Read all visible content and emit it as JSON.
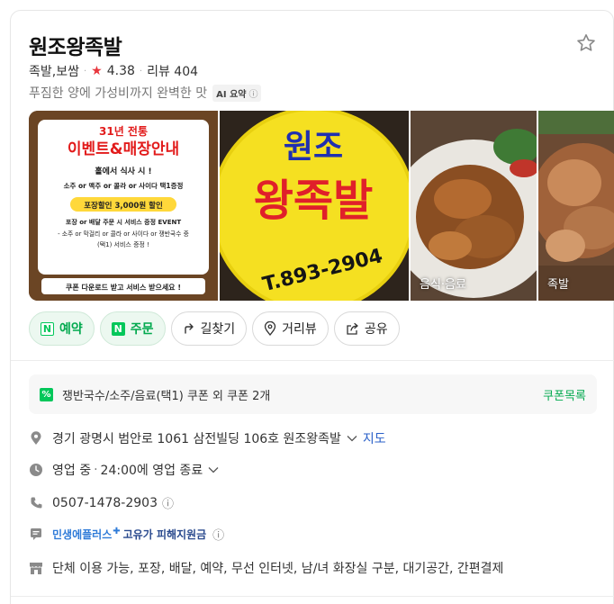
{
  "place": {
    "name": "원조왕족발",
    "category": "족발,보쌈",
    "rating": "4.38",
    "review_label": "리뷰 404",
    "summary": "푸짐한 양에 가성비까지 완벽한 맛",
    "ai_badge": "AI 요약"
  },
  "photos": {
    "poster_year": "31년 전통",
    "poster_name": "원조왕족발",
    "poster_headline": "이벤트&매장안내",
    "poster_line1": "홀에서 식사 시 !",
    "poster_line2": "소주 or 맥주 or 콜라 or 사이다 택1증정",
    "poster_discount": "포장할인 3,000원 할인",
    "poster_line3": "포장 or 배달 주문 시 서비스 증정 EVENT",
    "poster_line4": "- 소주 or 막걸리 or 콜라 or 사이다 or 쟁반국수 중",
    "poster_line5": "(택1) 서비스 증정 !",
    "poster_footer": "쿠폰 다운로드 받고 서비스 받으세요 !",
    "sign_top": "원조",
    "sign_main": "왕족발",
    "sign_phone": "T.893-2904",
    "label_food": "음식·음료",
    "label_jokbal": "족발"
  },
  "actions": [
    {
      "label": "예약",
      "icon": "naver-n-icon"
    },
    {
      "label": "주문",
      "icon": "naver-n-icon"
    },
    {
      "label": "길찾기",
      "icon": "direction-icon"
    },
    {
      "label": "거리뷰",
      "icon": "location-pin-icon"
    },
    {
      "label": "공유",
      "icon": "share-icon"
    }
  ],
  "coupon": {
    "text": "쟁반국수/소주/음료(택1) 쿠폰 외 쿠폰 2개",
    "link": "쿠폰목록"
  },
  "info": {
    "address": "경기 광명시 범안로 1061 삼전빌딩 106호 원조왕족발",
    "map_link": "지도",
    "status": "영업 중",
    "hours": "24:00에 영업 종료",
    "phone": "0507-1478-2903",
    "promo_a": "민생에플러스",
    "promo_b": "고유가 피해지원금",
    "amenities": "단체 이용 가능, 포장, 배달, 예약, 무선 인터넷, 남/녀 화장실 구분, 대기공간, 간편결제"
  },
  "colors": {
    "brand_green": "#03c75a",
    "rating_red": "#e8363d",
    "link_blue": "#2b61c9"
  }
}
